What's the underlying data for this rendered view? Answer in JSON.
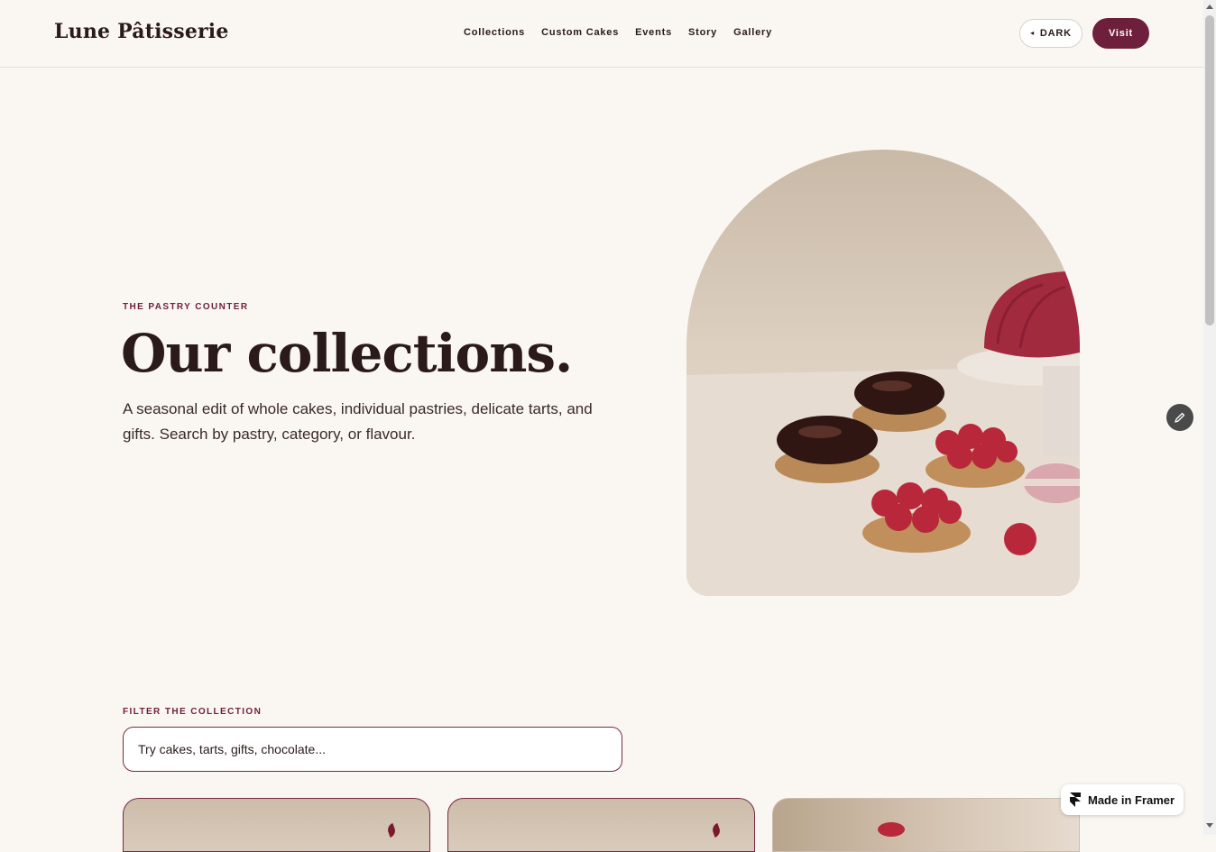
{
  "header": {
    "brand": "Lune Pâtisserie",
    "nav": [
      "Collections",
      "Custom Cakes",
      "Events",
      "Story",
      "Gallery"
    ],
    "dark_label": "DARK",
    "visit_label": "Visit"
  },
  "hero": {
    "eyebrow": "THE PASTRY COUNTER",
    "title": "Our collections.",
    "description": "A seasonal edit of whole cakes, individual pastries, delicate tarts, and gifts. Search by pastry, category, or flavour."
  },
  "filter": {
    "label": "FILTER THE COLLECTION",
    "placeholder": "Try cakes, tarts, gifts, chocolate..."
  },
  "badge": {
    "label": "Made in Framer"
  },
  "colors": {
    "accent": "#6e1f3c",
    "background": "#faf7f3",
    "text": "#2a1a1a"
  }
}
